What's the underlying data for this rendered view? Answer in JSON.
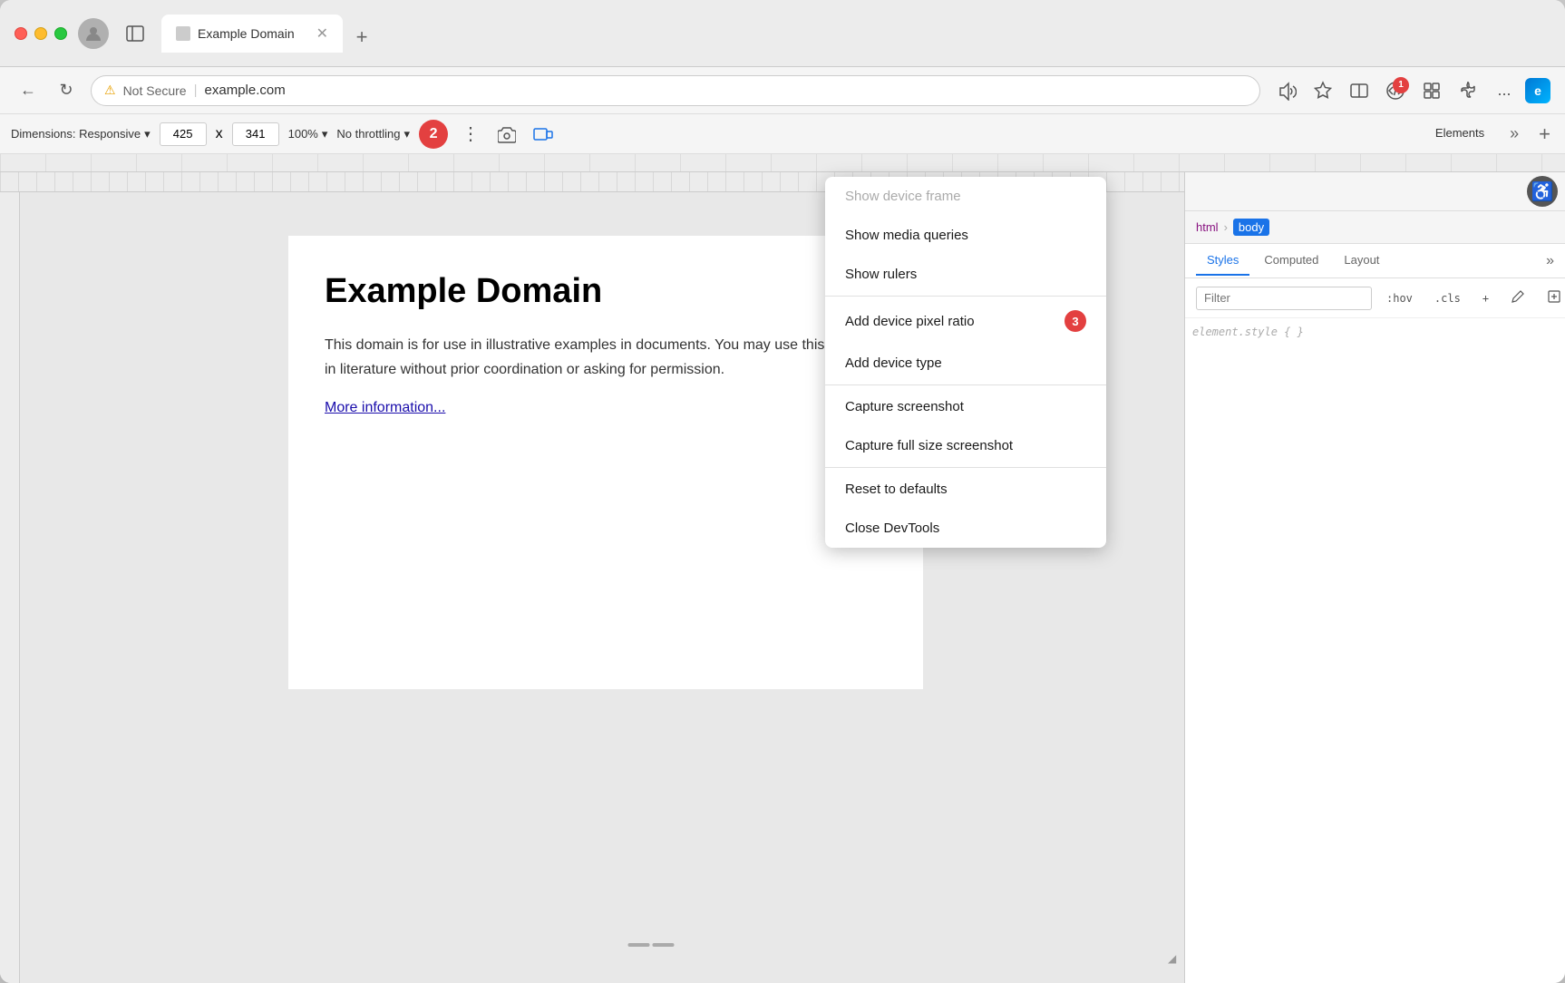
{
  "window": {
    "title": "Example Domain",
    "tab_label": "Example Domain",
    "favicon": "📄"
  },
  "address_bar": {
    "not_secure_label": "Not Secure",
    "url": "example.com"
  },
  "devtools_bar": {
    "dimensions_label": "Dimensions: Responsive",
    "width_value": "425",
    "height_value": "341",
    "zoom_label": "100%",
    "throttle_label": "No throttling",
    "badge1_label": "1",
    "badge2_label": "2"
  },
  "page": {
    "title": "Example Domain",
    "body_text": "This domain is for use in illustrative examples in documents. You may use this domain in literature without prior coordination or asking for permission.",
    "link_text": "More information..."
  },
  "dropdown": {
    "item1_label": "Show device frame",
    "item2_label": "Show media queries",
    "item3_label": "Show rulers",
    "item4_label": "Add device pixel ratio",
    "badge3_label": "3",
    "item5_label": "Add device type",
    "item6_label": "Capture screenshot",
    "item7_label": "Capture full size screenshot",
    "item8_label": "Reset to defaults",
    "item9_label": "Close DevTools"
  },
  "devtools_panel": {
    "tab_elements": "Elements",
    "breadcrumb_html": "html",
    "breadcrumb_body": "body",
    "tab_styles": "Styles",
    "tab_computed": "Computed",
    "tab_layout": "Layout",
    "filter_placeholder": "Filter",
    "btn_hov": ":hov",
    "btn_cls": ".cls"
  }
}
